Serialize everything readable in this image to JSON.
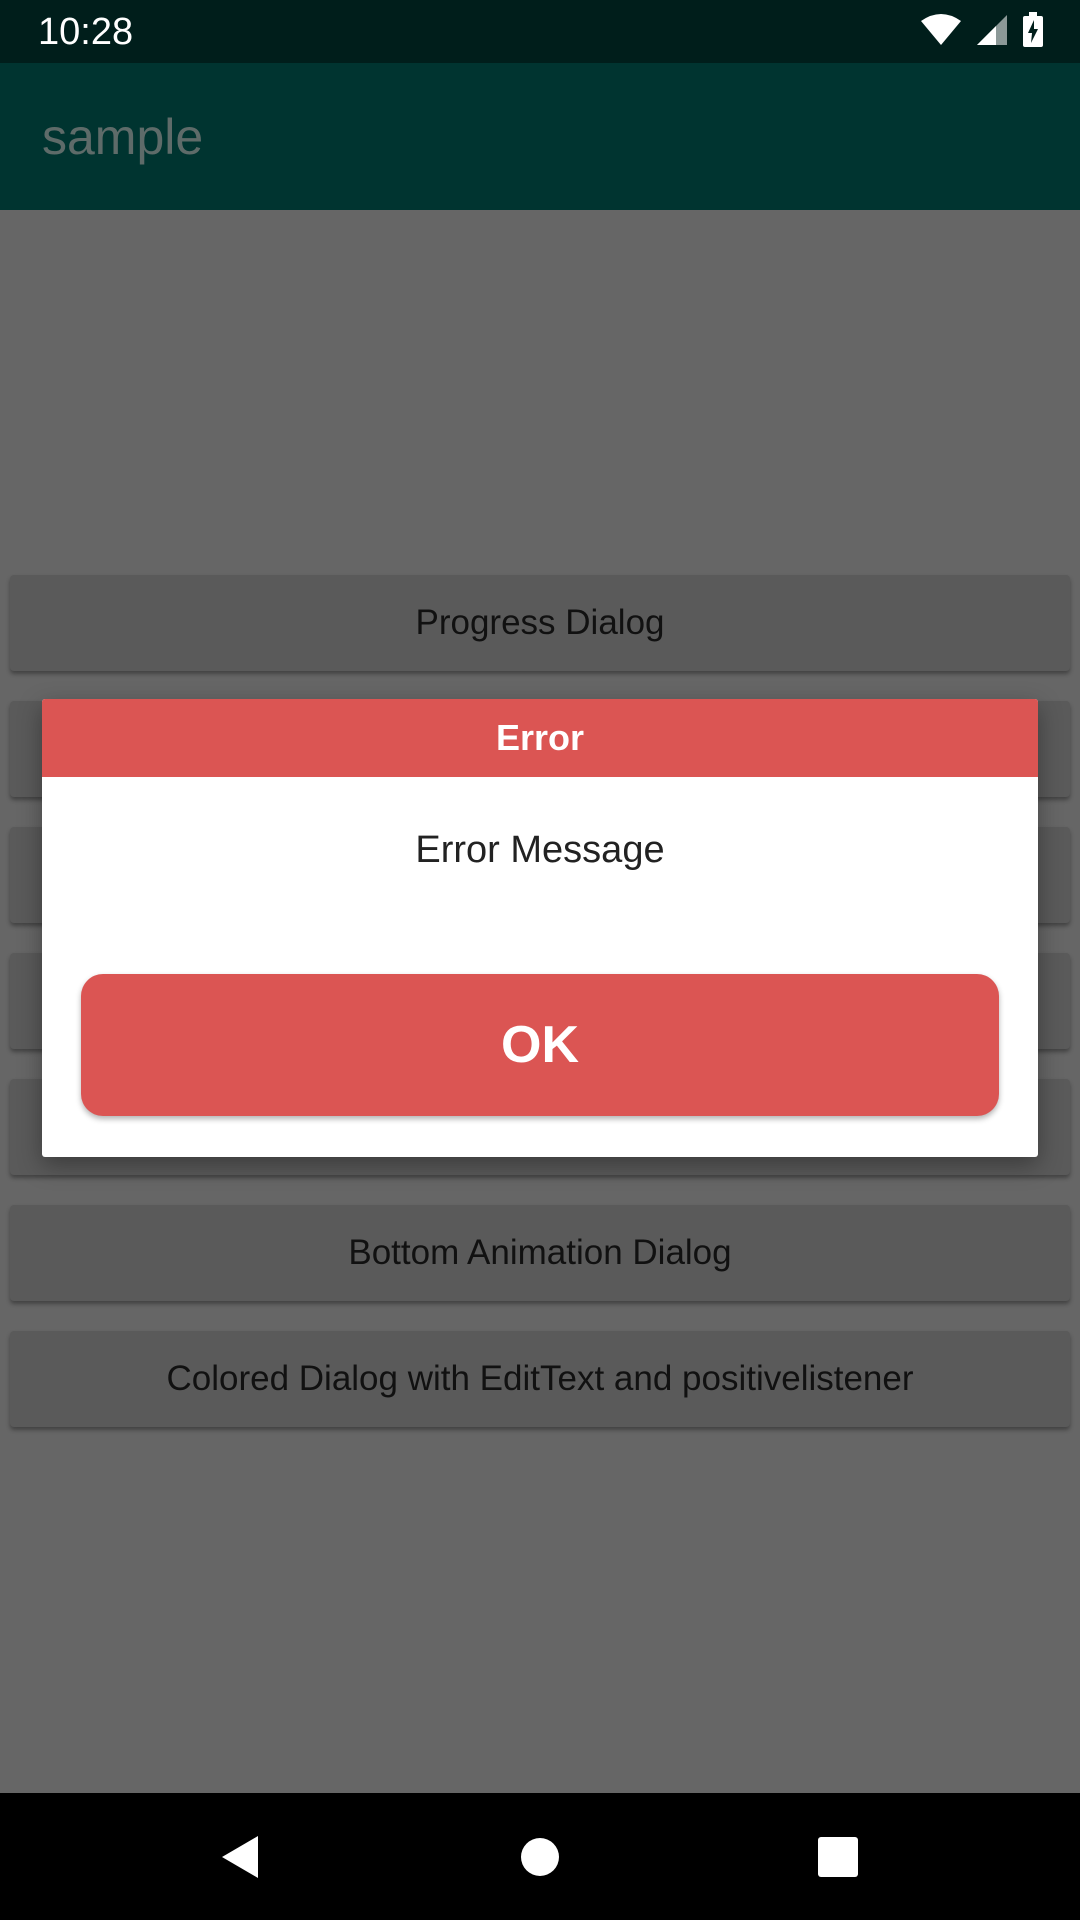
{
  "status_bar": {
    "time": "10:28",
    "icons": [
      "wifi-icon",
      "cell-signal-icon",
      "battery-charging-icon"
    ]
  },
  "app_bar": {
    "title": "sample"
  },
  "buttons": [
    {
      "label": "Progress Dialog"
    },
    {
      "label": ""
    },
    {
      "label": ""
    },
    {
      "label": ""
    },
    {
      "label": ""
    },
    {
      "label": "Bottom Animation Dialog"
    },
    {
      "label": "Colored Dialog with EditText and positivelistener"
    }
  ],
  "dialog": {
    "title": "Error",
    "message": "Error Message",
    "ok_label": "OK",
    "accent_color": "#db5553"
  },
  "nav_bar": {
    "items": [
      "back-icon",
      "home-icon",
      "recents-icon"
    ]
  },
  "colors": {
    "status_bar": "#001e1b",
    "app_bar": "#003430",
    "scrim_background": "#666666",
    "dialog_accent": "#db5553"
  }
}
